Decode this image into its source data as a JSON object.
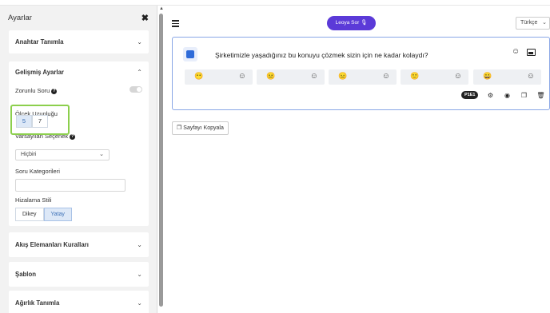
{
  "sidebar": {
    "title": "Ayarlar",
    "close_icon": "close-icon",
    "sections": {
      "anahtar": {
        "title": "Anahtar Tanımla"
      },
      "gelismis": {
        "title": "Gelişmiş Ayarlar",
        "required_label": "Zorunlu Soru",
        "required_toggle": false,
        "scale_label": "Ölçek Uzunluğu",
        "scale_options": [
          "5",
          "7"
        ],
        "scale_selected": "5",
        "default_label": "Varsayılan Seçenek",
        "default_value": "Hiçbiri",
        "category_label": "Soru Kategorileri",
        "category_value": "",
        "align_label": "Hizalama Stili",
        "align_options": [
          "Dikey",
          "Yatay"
        ],
        "align_selected": "Yatay"
      },
      "akis": {
        "title": "Akış Elemanları Kuralları"
      },
      "sablon": {
        "title": "Şablon"
      },
      "agirlik": {
        "title": "Ağırlık Tanımla"
      }
    }
  },
  "header": {
    "ask_button": "Leoya Sor",
    "language": "Türkçe"
  },
  "question": {
    "text": "Şirketimizle yaşadığınız bu konuyu çözmek sizin için ne kadar kolaydı?",
    "options": [
      {
        "face": "😶"
      },
      {
        "face": "😐"
      },
      {
        "face": "😑"
      },
      {
        "face": "🙂"
      },
      {
        "face": "😀"
      }
    ],
    "id_pill": "P1E1"
  },
  "copy_page_label": "Sayfayı Kopyala",
  "colors": {
    "accent": "#5b3ad8",
    "card_border": "#8aa7e6",
    "highlight": "#8ccf4d"
  }
}
